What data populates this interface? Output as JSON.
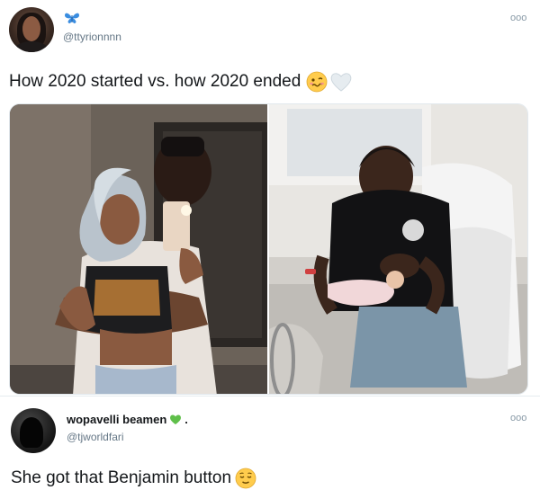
{
  "tweet": {
    "handle": "@ttyrionnnn",
    "more_label": "ooo",
    "text": "How 2020 started vs. how 2020 ended",
    "emojis": [
      "woozy-face-emoji",
      "white-heart-emoji"
    ],
    "badge_icon": "butterfly-icon",
    "colors": {
      "butterfly": "#3a8de0",
      "handle": "#657786",
      "text": "#14171a"
    }
  },
  "media": {
    "photos": [
      {
        "name": "photo-2020-started"
      },
      {
        "name": "photo-2020-ended"
      }
    ]
  },
  "reply": {
    "name": "wopavelli beamen",
    "name_suffix": ".",
    "name_icon": "green-heart-icon",
    "handle": "@tjworldfari",
    "more_label": "ooo",
    "text": "She got that Benjamin button",
    "emoji": "relieved-face-emoji",
    "colors": {
      "heart": "#5fbf4a"
    }
  }
}
